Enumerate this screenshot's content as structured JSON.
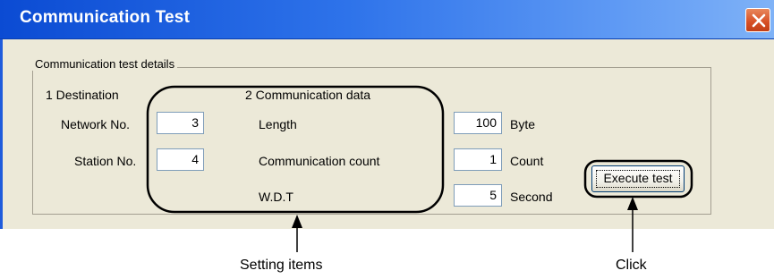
{
  "window": {
    "title": "Communication Test"
  },
  "group": {
    "title": "Communication test details"
  },
  "destination": {
    "heading": "1 Destination",
    "network_label": "Network No.",
    "network_value": "3",
    "station_label": "Station No.",
    "station_value": "4"
  },
  "comm_data": {
    "heading": "2 Communication data",
    "length_label": "Length",
    "length_value": "100",
    "length_unit": "Byte",
    "count_label": "Communication count",
    "count_value": "1",
    "count_unit": "Count",
    "wdt_label": "W.D.T",
    "wdt_value": "5",
    "wdt_unit": "Second"
  },
  "buttons": {
    "execute_label": "Execute test"
  },
  "annotations": {
    "setting_items": "Setting items",
    "click": "Click"
  },
  "colors": {
    "titlebar": "#0b4bd3",
    "dialog_bg": "#ece9d8",
    "close_button": "#d64f25"
  },
  "icons": {
    "close": "close-icon"
  }
}
